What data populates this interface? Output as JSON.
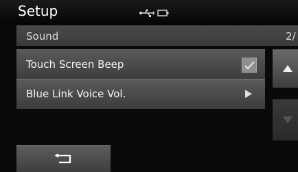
{
  "header": {
    "title": "Setup",
    "status_icons": [
      "usb-icon",
      "battery-icon"
    ]
  },
  "subheader": {
    "label": "Sound",
    "page_indicator": "2/"
  },
  "list": {
    "items": [
      {
        "label": "Touch Screen Beep",
        "control": "checkbox",
        "checked": true
      },
      {
        "label": "Blue Link Voice Vol.",
        "control": "arrow-right-icon"
      }
    ]
  },
  "scroll": {
    "up_icon": "triangle-up-icon",
    "down_icon": "triangle-down-icon"
  },
  "footer": {
    "back_icon": "return-arrow-icon"
  },
  "colors": {
    "background": "#0a0a0a",
    "row": "#4a4a4a",
    "text": "#f2f2f2"
  }
}
